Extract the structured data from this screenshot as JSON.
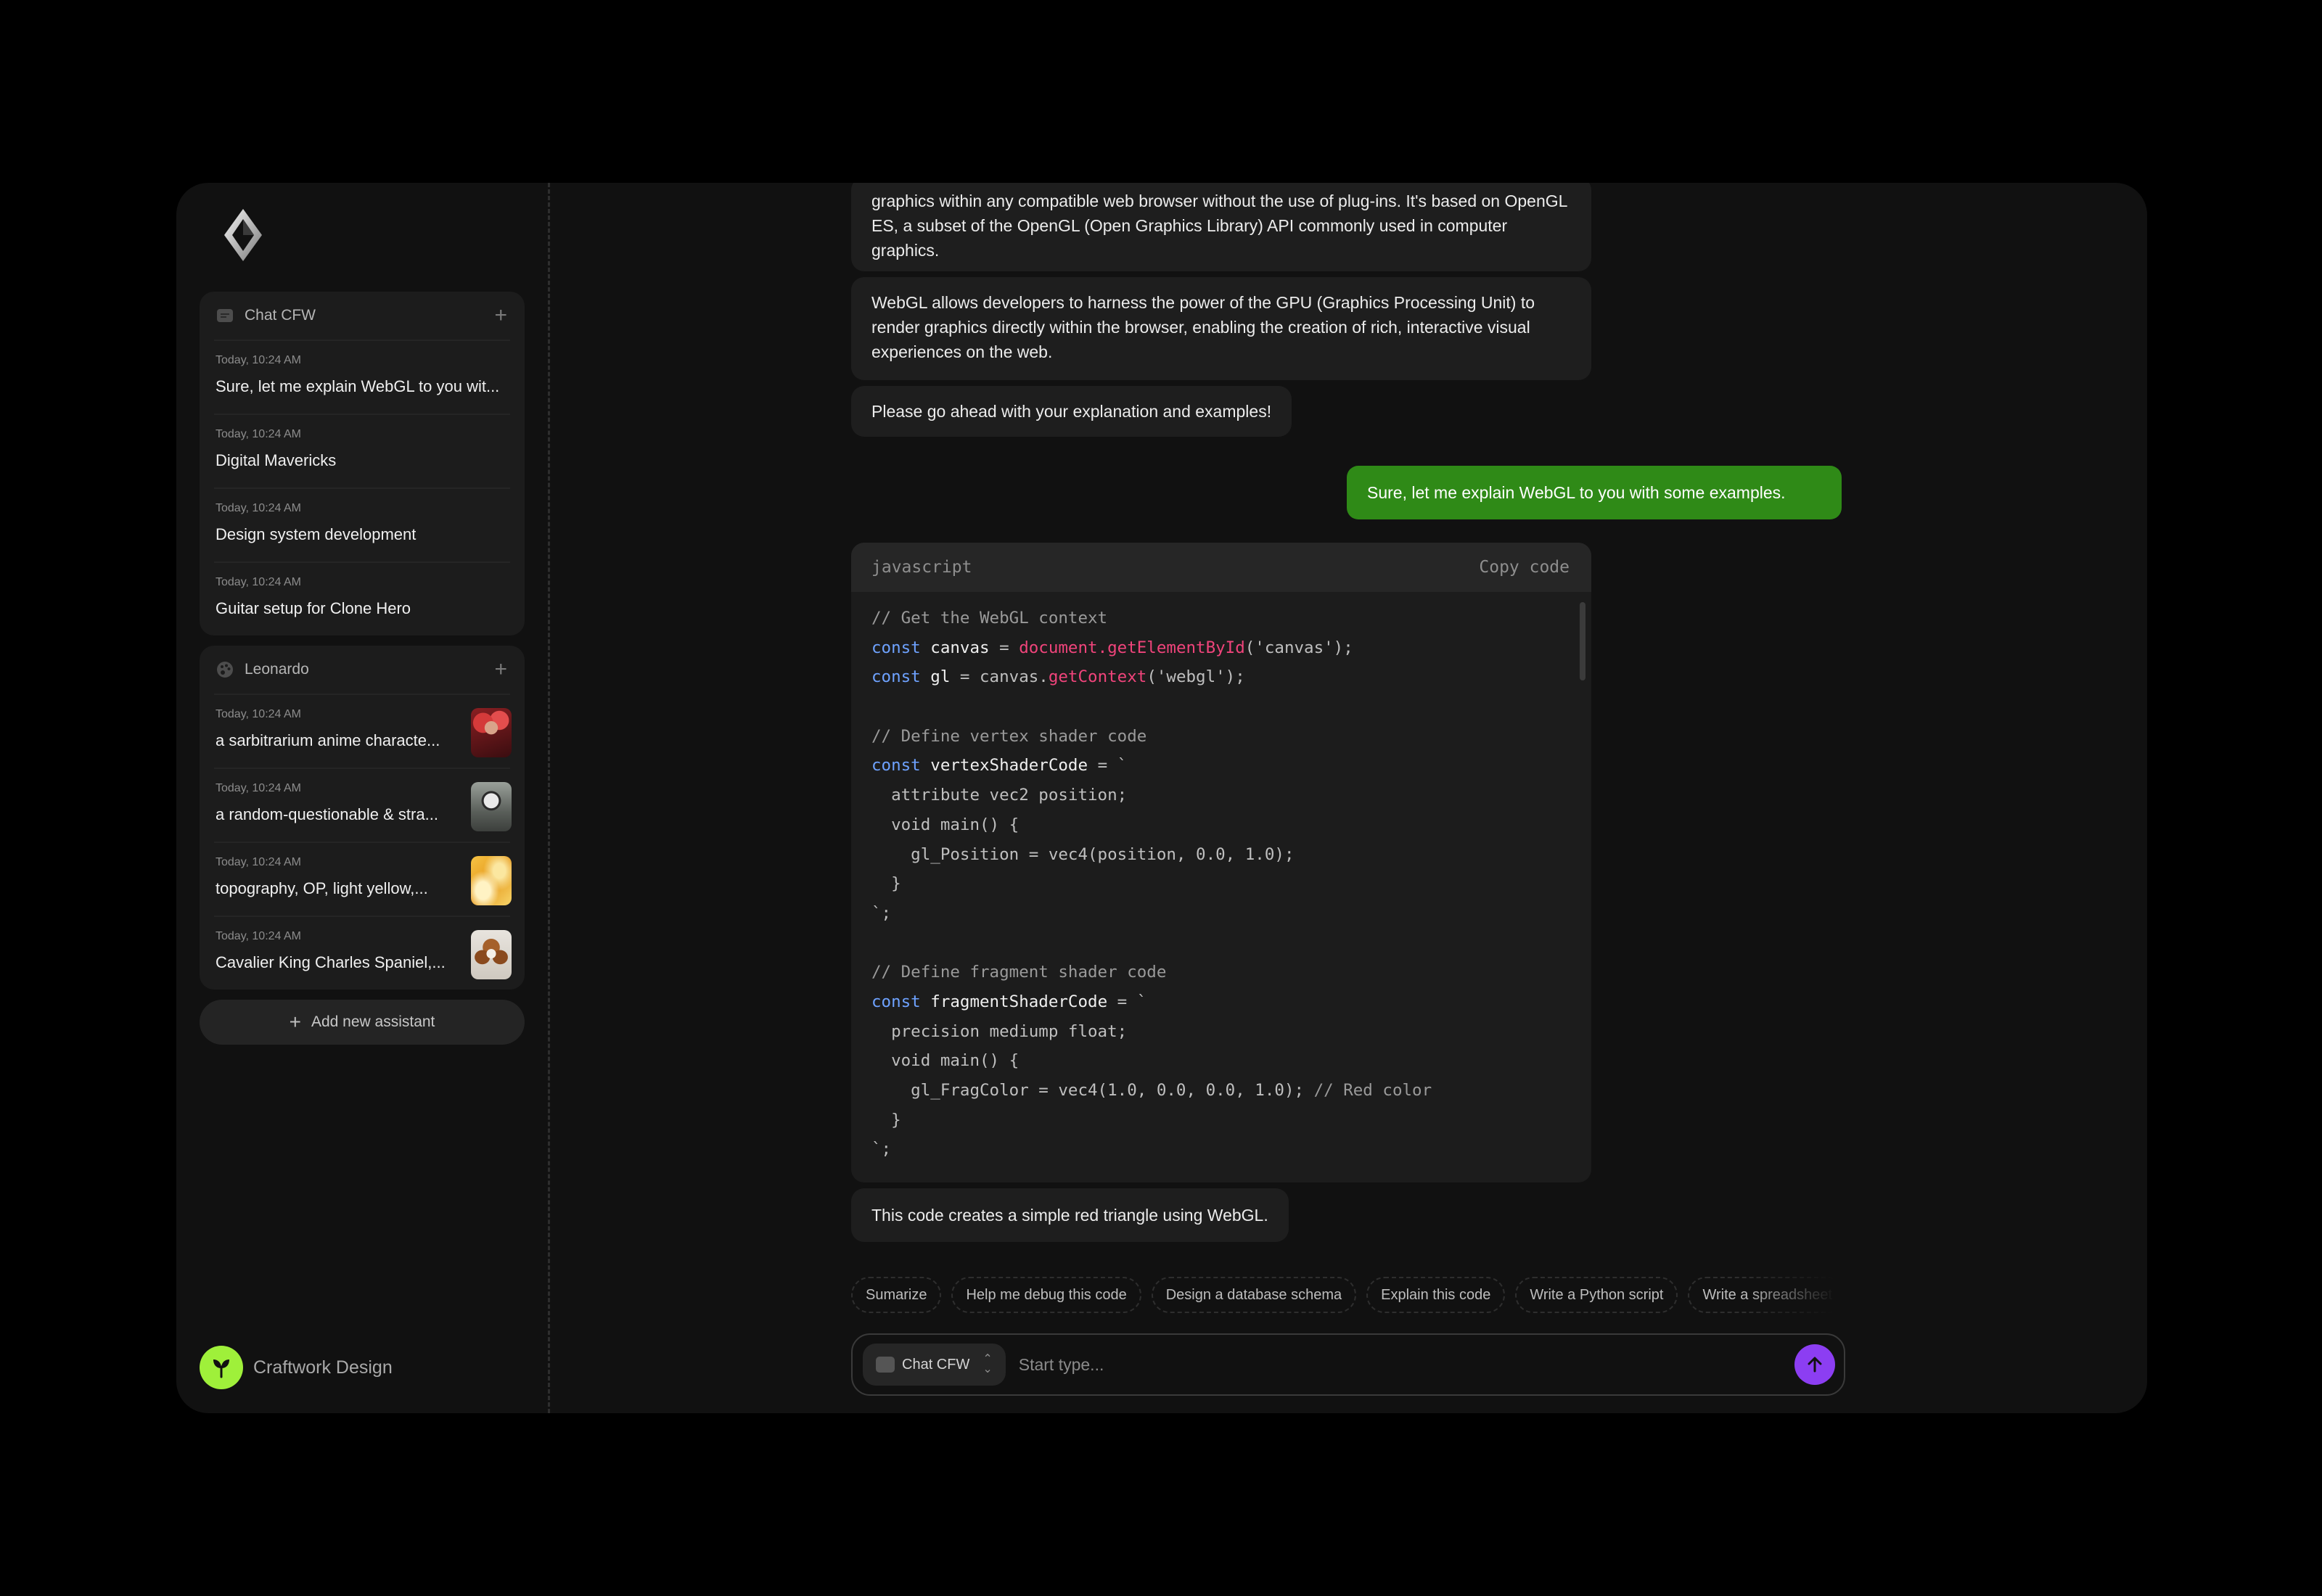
{
  "sidebar": {
    "logo_icon": "diamond-logo-icon",
    "chat_panel": {
      "title": "Chat CFW",
      "icon": "chat-icon",
      "items": [
        {
          "time": "Today, 10:24 AM",
          "title": "Sure, let me explain WebGL to you wit..."
        },
        {
          "time": "Today, 10:24 AM",
          "title": "Digital Mavericks"
        },
        {
          "time": "Today, 10:24 AM",
          "title": "Design system development"
        },
        {
          "time": "Today, 10:24 AM",
          "title": "Guitar setup for Clone Hero"
        }
      ]
    },
    "leonardo_panel": {
      "title": "Leonardo",
      "icon": "palette-icon",
      "items": [
        {
          "time": "Today, 10:24 AM",
          "title": "a sarbitrarium anime characte..."
        },
        {
          "time": "Today, 10:24 AM",
          "title": "a random-questionable & stra..."
        },
        {
          "time": "Today, 10:24 AM",
          "title": "topography, OP, light yellow,..."
        },
        {
          "time": "Today, 10:24 AM",
          "title": "Cavalier King Charles Spaniel,..."
        }
      ]
    },
    "add_assistant_label": "Add new assistant",
    "brand_name": "Craftwork Design"
  },
  "messages": {
    "m1": "graphics within any compatible web browser without the use of plug-ins. It's based on OpenGL ES, a subset of the OpenGL (Open Graphics Library) API commonly used in computer graphics.",
    "m2": "WebGL allows developers to harness the power of the GPU (Graphics Processing Unit) to render graphics directly within the browser, enabling the creation of rich, interactive visual experiences on the web.",
    "m3": "Please go ahead with your explanation and examples!",
    "user": "Sure, let me explain WebGL to you with some examples.",
    "m4": "This code creates a simple red triangle using WebGL."
  },
  "code": {
    "language": "javascript",
    "copy_label": "Copy code",
    "lines": [
      "// Get the WebGL context",
      "const canvas = document.getElementById('canvas');",
      "const gl = canvas.getContext('webgl');",
      "",
      "// Define vertex shader code",
      "const vertexShaderCode = `",
      "  attribute vec2 position;",
      "  void main() {",
      "    gl_Position = vec4(position, 0.0, 1.0);",
      "  }",
      "`;",
      "",
      "// Define fragment shader code",
      "const fragmentShaderCode = `",
      "  precision mediump float;",
      "  void main() {",
      "    gl_FragColor = vec4(1.0, 0.0, 0.0, 1.0); // Red color",
      "  }",
      "`;"
    ]
  },
  "suggestions": [
    "Sumarize",
    "Help me debug this code",
    "Design a database schema",
    "Explain this code",
    "Write a Python script",
    "Write a spreadsheet"
  ],
  "composer": {
    "model": "Chat CFW",
    "placeholder": "Start type..."
  },
  "colors": {
    "user_bubble": "#2f8a17",
    "send_button": "#8c3ef2",
    "brand_badge": "#9ff03a",
    "keyword": "#6ea2ff",
    "function": "#f0447b"
  }
}
